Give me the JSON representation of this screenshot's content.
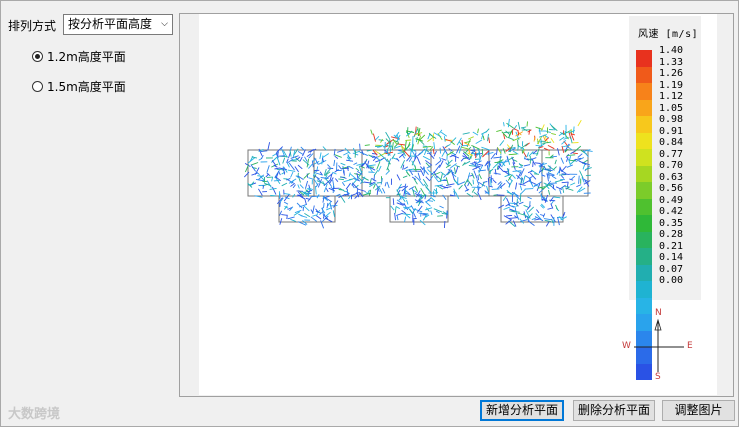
{
  "left_panel": {
    "sort_label": "排列方式",
    "sort_select": "按分析平面高度",
    "radios": [
      {
        "label": "1.2m高度平面",
        "checked": true
      },
      {
        "label": "1.5m高度平面",
        "checked": false
      }
    ]
  },
  "legend": {
    "title": "风速 [m/s]",
    "ticks": [
      "1.40",
      "1.33",
      "1.26",
      "1.19",
      "1.12",
      "1.05",
      "0.98",
      "0.91",
      "0.84",
      "0.77",
      "0.70",
      "0.63",
      "0.56",
      "0.49",
      "0.42",
      "0.35",
      "0.28",
      "0.21",
      "0.14",
      "0.07",
      "0.00"
    ],
    "colors": [
      "#e8321e",
      "#f05a1a",
      "#f7821a",
      "#f9a51a",
      "#f7c81c",
      "#eee21e",
      "#cfe21f",
      "#a6d722",
      "#7ccc2a",
      "#4fc12f",
      "#2fb838",
      "#29b35e",
      "#25b087",
      "#21aeb0",
      "#1fb3d2",
      "#28b4e6",
      "#2aa3ec",
      "#2b86ec",
      "#2b6be9",
      "#2a52e5"
    ]
  },
  "compass": {
    "n": "N",
    "s": "S",
    "e": "E",
    "w": "W"
  },
  "bottom": {
    "watermark": "大数跨境",
    "btn_add": "新增分析平面",
    "btn_delete": "删除分析平面",
    "btn_adjust": "调整图片"
  }
}
